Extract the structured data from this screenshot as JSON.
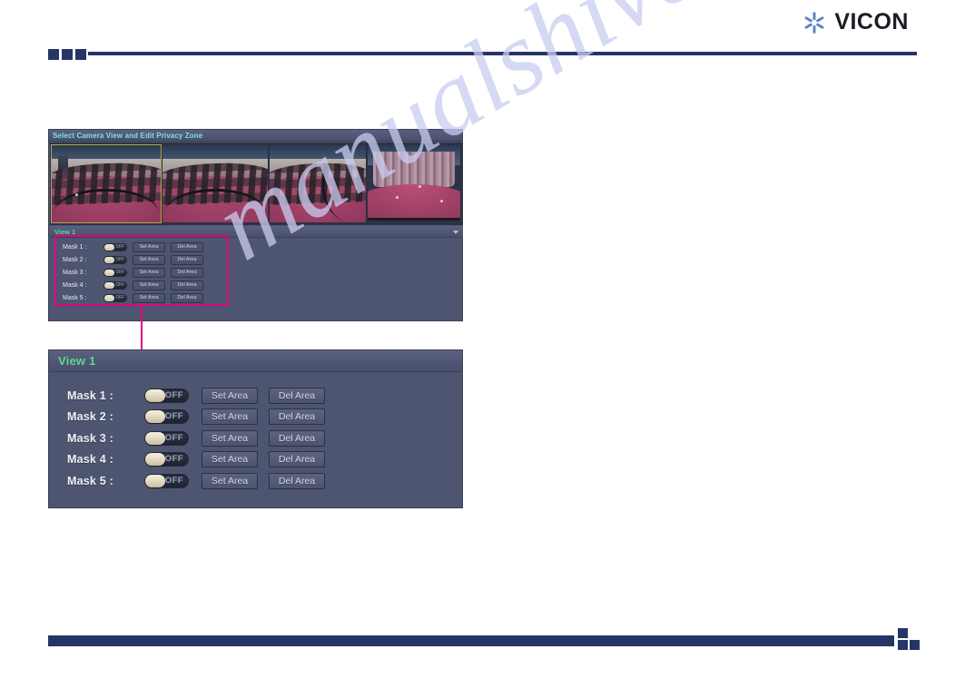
{
  "brand": {
    "name": "VICON",
    "logo_icon": "vicon-asterisk-icon",
    "logo_color": "#5b84c4",
    "text_color": "#1c1c24"
  },
  "theme": {
    "rule_color": "#253566",
    "panel_bg": "#4e5570",
    "titlebar_text_cyan": "#7fe3df",
    "titlebar_text_green": "#5bd98f",
    "callout_color": "#e5007e",
    "selected_camera_border": "#b3a64a"
  },
  "watermark": {
    "text": "manualshive.com",
    "color": "#c9cdf0"
  },
  "screenshot_panel": {
    "titlebar": {
      "text": "Select Camera View and Edit Privacy Zone"
    },
    "cameras": [
      {
        "label": "camera-view-1",
        "selected": true
      },
      {
        "label": "camera-view-2",
        "selected": false
      },
      {
        "label": "camera-view-3",
        "selected": false
      },
      {
        "label": "camera-view-4",
        "selected": false
      }
    ],
    "view_bar": {
      "text": "View 1",
      "caret_icon": "chevron-down-icon"
    },
    "masks": [
      {
        "label": "Mask 1 :",
        "toggle": "OFF",
        "set_label": "Set Area",
        "del_label": "Del Area"
      },
      {
        "label": "Mask 2 :",
        "toggle": "OFF",
        "set_label": "Set Area",
        "del_label": "Del Area"
      },
      {
        "label": "Mask 3 :",
        "toggle": "OFF",
        "set_label": "Set Area",
        "del_label": "Del Area"
      },
      {
        "label": "Mask 4 :",
        "toggle": "OFF",
        "set_label": "Set Area",
        "del_label": "Del Area"
      },
      {
        "label": "Mask 5 :",
        "toggle": "OFF",
        "set_label": "Set Area",
        "del_label": "Del Area"
      }
    ]
  },
  "detail_panel": {
    "titlebar": {
      "text": "View 1"
    },
    "masks": [
      {
        "label": "Mask 1 :",
        "toggle": "OFF",
        "set_label": "Set Area",
        "del_label": "Del Area"
      },
      {
        "label": "Mask 2 :",
        "toggle": "OFF",
        "set_label": "Set Area",
        "del_label": "Del Area"
      },
      {
        "label": "Mask 3 :",
        "toggle": "OFF",
        "set_label": "Set Area",
        "del_label": "Del Area"
      },
      {
        "label": "Mask 4 :",
        "toggle": "OFF",
        "set_label": "Set Area",
        "del_label": "Del Area"
      },
      {
        "label": "Mask 5 :",
        "toggle": "OFF",
        "set_label": "Set Area",
        "del_label": "Del Area"
      }
    ]
  }
}
